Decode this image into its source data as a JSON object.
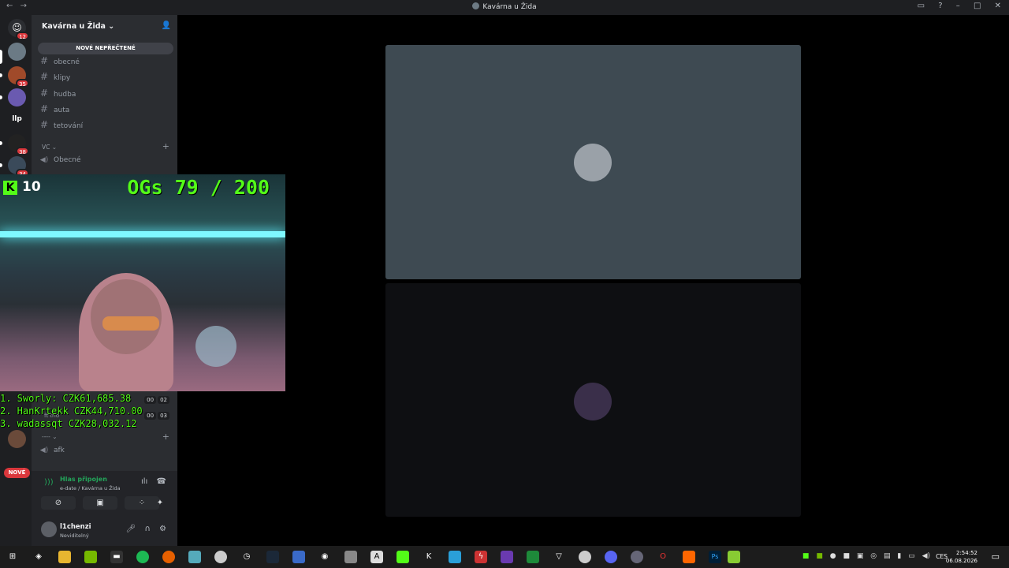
{
  "window": {
    "title": "Kavárna u Žida",
    "back": "←",
    "forward": "→"
  },
  "server": {
    "name": "Kavárna u Žida ⌄",
    "unread_button": "NOVÉ NEPŘEČTENÉ"
  },
  "guild_badges": {
    "dm": "12",
    "g2": "35",
    "g5": "38",
    "g6": "34",
    "text_guild": "llp",
    "new_pill": "NOVÉ"
  },
  "text_channels": [
    "obecné",
    "klipy",
    "hudba",
    "auta",
    "tetování"
  ],
  "voice_category": "VC ⌄",
  "voice_channels": {
    "obecne": "Obecné",
    "ft_trio": "ft trio",
    "unnamed_cat": "---- ⌄",
    "afk": "afk"
  },
  "timers": {
    "t1_a": "00",
    "t1_b": "02",
    "t2_a": "00",
    "t2_b": "03"
  },
  "voice_panel": {
    "status": "Hlas připojen",
    "sub": "e-date / Kavárna u Žida"
  },
  "user": {
    "name": "l1chenzi",
    "status": "Neviditelný"
  },
  "stream_overlay": {
    "kick_count": "10",
    "kick_letter": "K",
    "ogs": "OGs 79 / 200",
    "leaderboard": [
      "1. Sworly: CZK61,685.38",
      "2. HanKrtekk CZK44,710.00",
      "3. wadassqt CZK28,032.12"
    ]
  },
  "taskbar": {
    "lang": "CES",
    "time": "2:54:52",
    "date": "06.08.2026"
  },
  "colors": {
    "kick_green": "#53fc18",
    "discord_green": "#23a55a",
    "badge_red": "#da373c"
  }
}
